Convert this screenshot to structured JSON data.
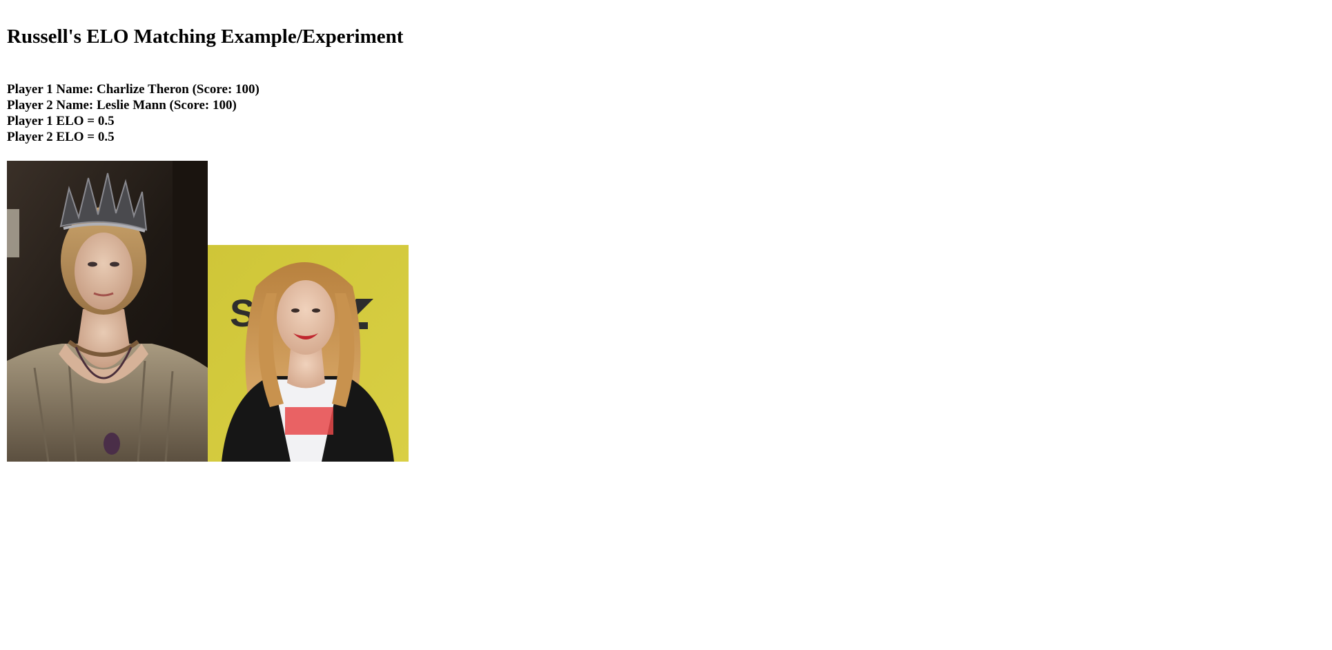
{
  "page": {
    "title": "Russell's ELO Matching Example/Experiment"
  },
  "players": [
    {
      "name_line": "Player 1 Name: Charlize Theron (Score: 100)",
      "elo_line": "Player 1 ELO = 0.5",
      "photo_icon": "portrait-photo-queen"
    },
    {
      "name_line": "Player 2 Name: Leslie Mann (Score: 100)",
      "elo_line": "Player 2 ELO = 0.5",
      "photo_icon": "portrait-photo-yellow-backdrop"
    }
  ],
  "colors": {
    "photo2_backdrop": "#d4c93a",
    "photo1_backdrop": "#2a231c"
  }
}
